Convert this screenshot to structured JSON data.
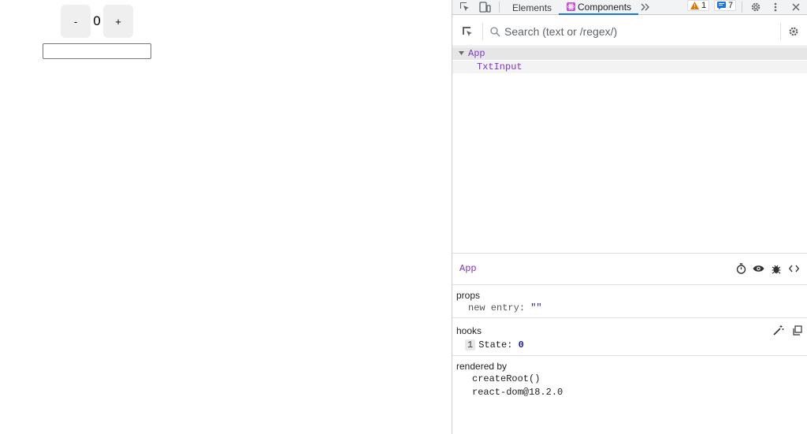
{
  "app": {
    "decrement_label": "-",
    "count": "0",
    "increment_label": "+",
    "text_input_value": ""
  },
  "devtools": {
    "tabs": {
      "elements": "Elements",
      "components": "Components"
    },
    "warnings_count": "1",
    "messages_count": "7",
    "search_placeholder": "Search (text or /regex/)",
    "tree": [
      {
        "name": "App",
        "expanded": true
      },
      {
        "name": "TxtInput"
      }
    ],
    "inspected_component": "App",
    "props": {
      "title": "props",
      "key": "new entry",
      "value": "\"\""
    },
    "hooks": {
      "title": "hooks",
      "index": "1",
      "name": "State",
      "value": "0"
    },
    "rendered_by": {
      "title": "rendered by",
      "items": [
        "createRoot()",
        "react-dom@18.2.0"
      ]
    },
    "colors": {
      "component_purple": "#7e36c9",
      "tab_active_blue": "#1a73e8",
      "toolbar_bg": "#f1f3f4",
      "selected_row": "#e6e6e6",
      "warning_orange": "#e37400",
      "message_blue": "#1a73e8"
    }
  }
}
